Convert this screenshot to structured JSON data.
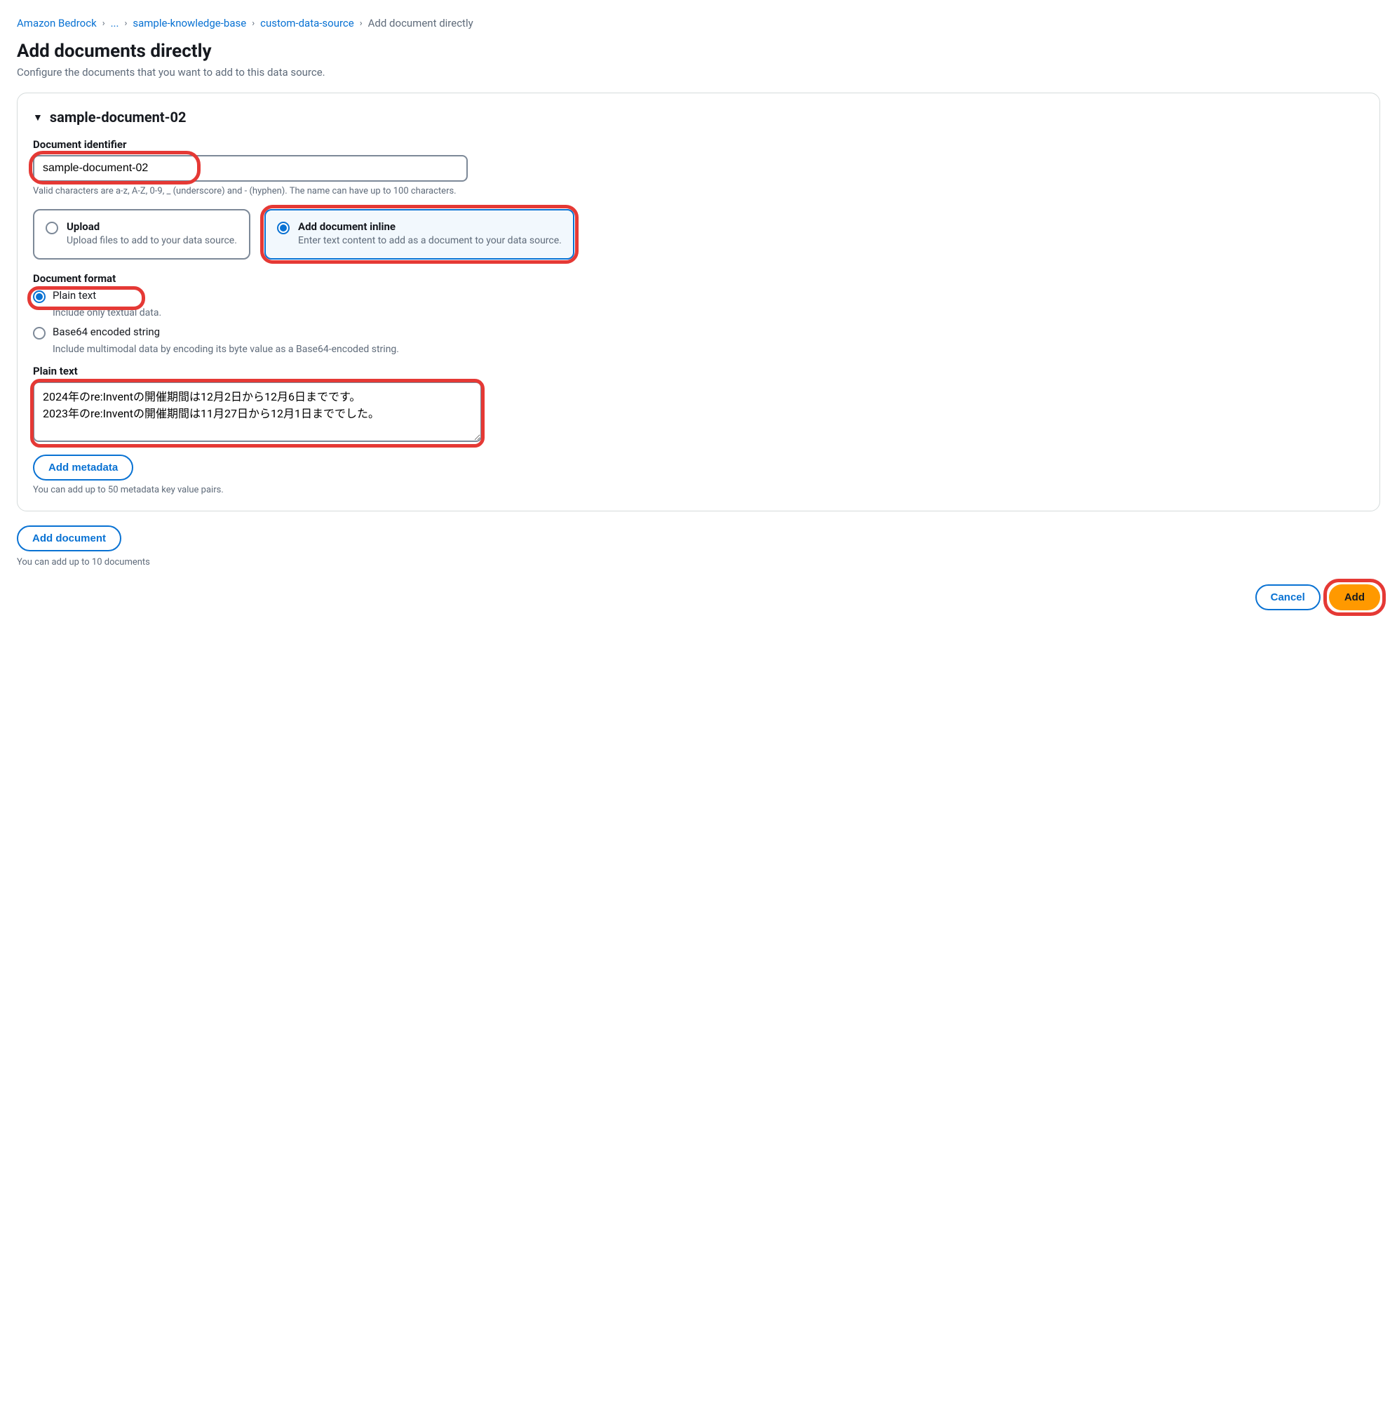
{
  "breadcrumb": {
    "items": [
      "Amazon Bedrock",
      "...",
      "sample-knowledge-base",
      "custom-data-source"
    ],
    "current": "Add document directly"
  },
  "page": {
    "title": "Add documents directly",
    "subtitle": "Configure the documents that you want to add to this data source."
  },
  "document": {
    "name": "sample-document-02",
    "identifier": {
      "label": "Document identifier",
      "value": "sample-document-02",
      "help": "Valid characters are a-z, A-Z, 0-9, _ (underscore) and - (hyphen). The name can have up to 100 characters."
    },
    "method": {
      "upload": {
        "title": "Upload",
        "desc": "Upload files to add to your data source."
      },
      "inline": {
        "title": "Add document inline",
        "desc": "Enter text content to add as a document to your data source."
      }
    },
    "format": {
      "label": "Document format",
      "plain": {
        "label": "Plain text",
        "desc": "Include only textual data."
      },
      "base64": {
        "label": "Base64 encoded string",
        "desc": "Include multimodal data by encoding its byte value as a Base64-encoded string."
      }
    },
    "plainText": {
      "label": "Plain text",
      "value": "2024年のre:Inventの開催期間は12月2日から12月6日までです。\n2023年のre:Inventの開催期間は11月27日から12月1日まででした。"
    },
    "metadata": {
      "button": "Add metadata",
      "help": "You can add up to 50 metadata key value pairs."
    }
  },
  "addDocument": {
    "button": "Add document",
    "help": "You can add up to 10 documents"
  },
  "actions": {
    "cancel": "Cancel",
    "add": "Add"
  }
}
